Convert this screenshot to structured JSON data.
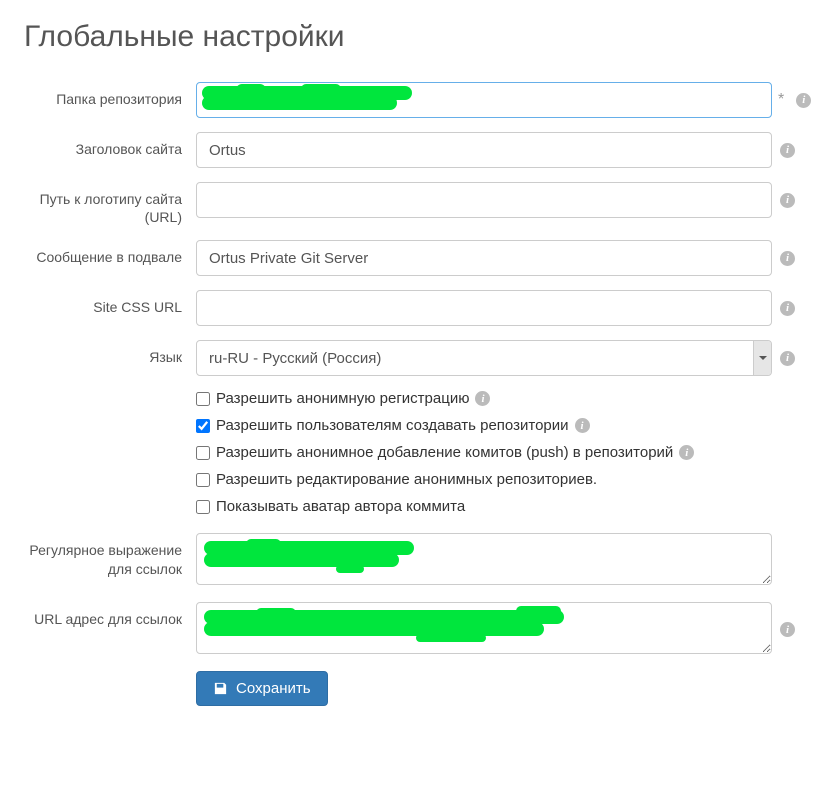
{
  "page_title": "Глобальные настройки",
  "labels": {
    "repo_folder": "Папка репозитория",
    "site_title": "Заголовок сайта",
    "logo_url": "Путь к логотипу сайта (URL)",
    "footer_msg": "Сообщение в подвале",
    "site_css": "Site CSS URL",
    "language": "Язык",
    "link_regex": "Регулярное выражение для ссылок",
    "link_url": "URL адрес для ссылок"
  },
  "values": {
    "repo_folder": "",
    "site_title": "Ortus",
    "logo_url": "",
    "footer_msg": "Ortus Private Git Server",
    "site_css": "",
    "language": "ru-RU - Русский (Россия)",
    "link_regex": "",
    "link_url": ""
  },
  "checkboxes": [
    {
      "label": "Разрешить анонимную регистрацию",
      "checked": false,
      "info": true
    },
    {
      "label": "Разрешить пользователям создавать репозитории",
      "checked": true,
      "info": true
    },
    {
      "label": "Разрешить анонимное добавление комитов (push) в репозиторий",
      "checked": false,
      "info": true
    },
    {
      "label": "Разрешить редактирование анонимных репозиториев.",
      "checked": false,
      "info": false
    },
    {
      "label": "Показывать аватар автора коммита",
      "checked": false,
      "info": false
    }
  ],
  "required_marker": "*",
  "info_glyph": "i",
  "save_label": "Сохранить"
}
